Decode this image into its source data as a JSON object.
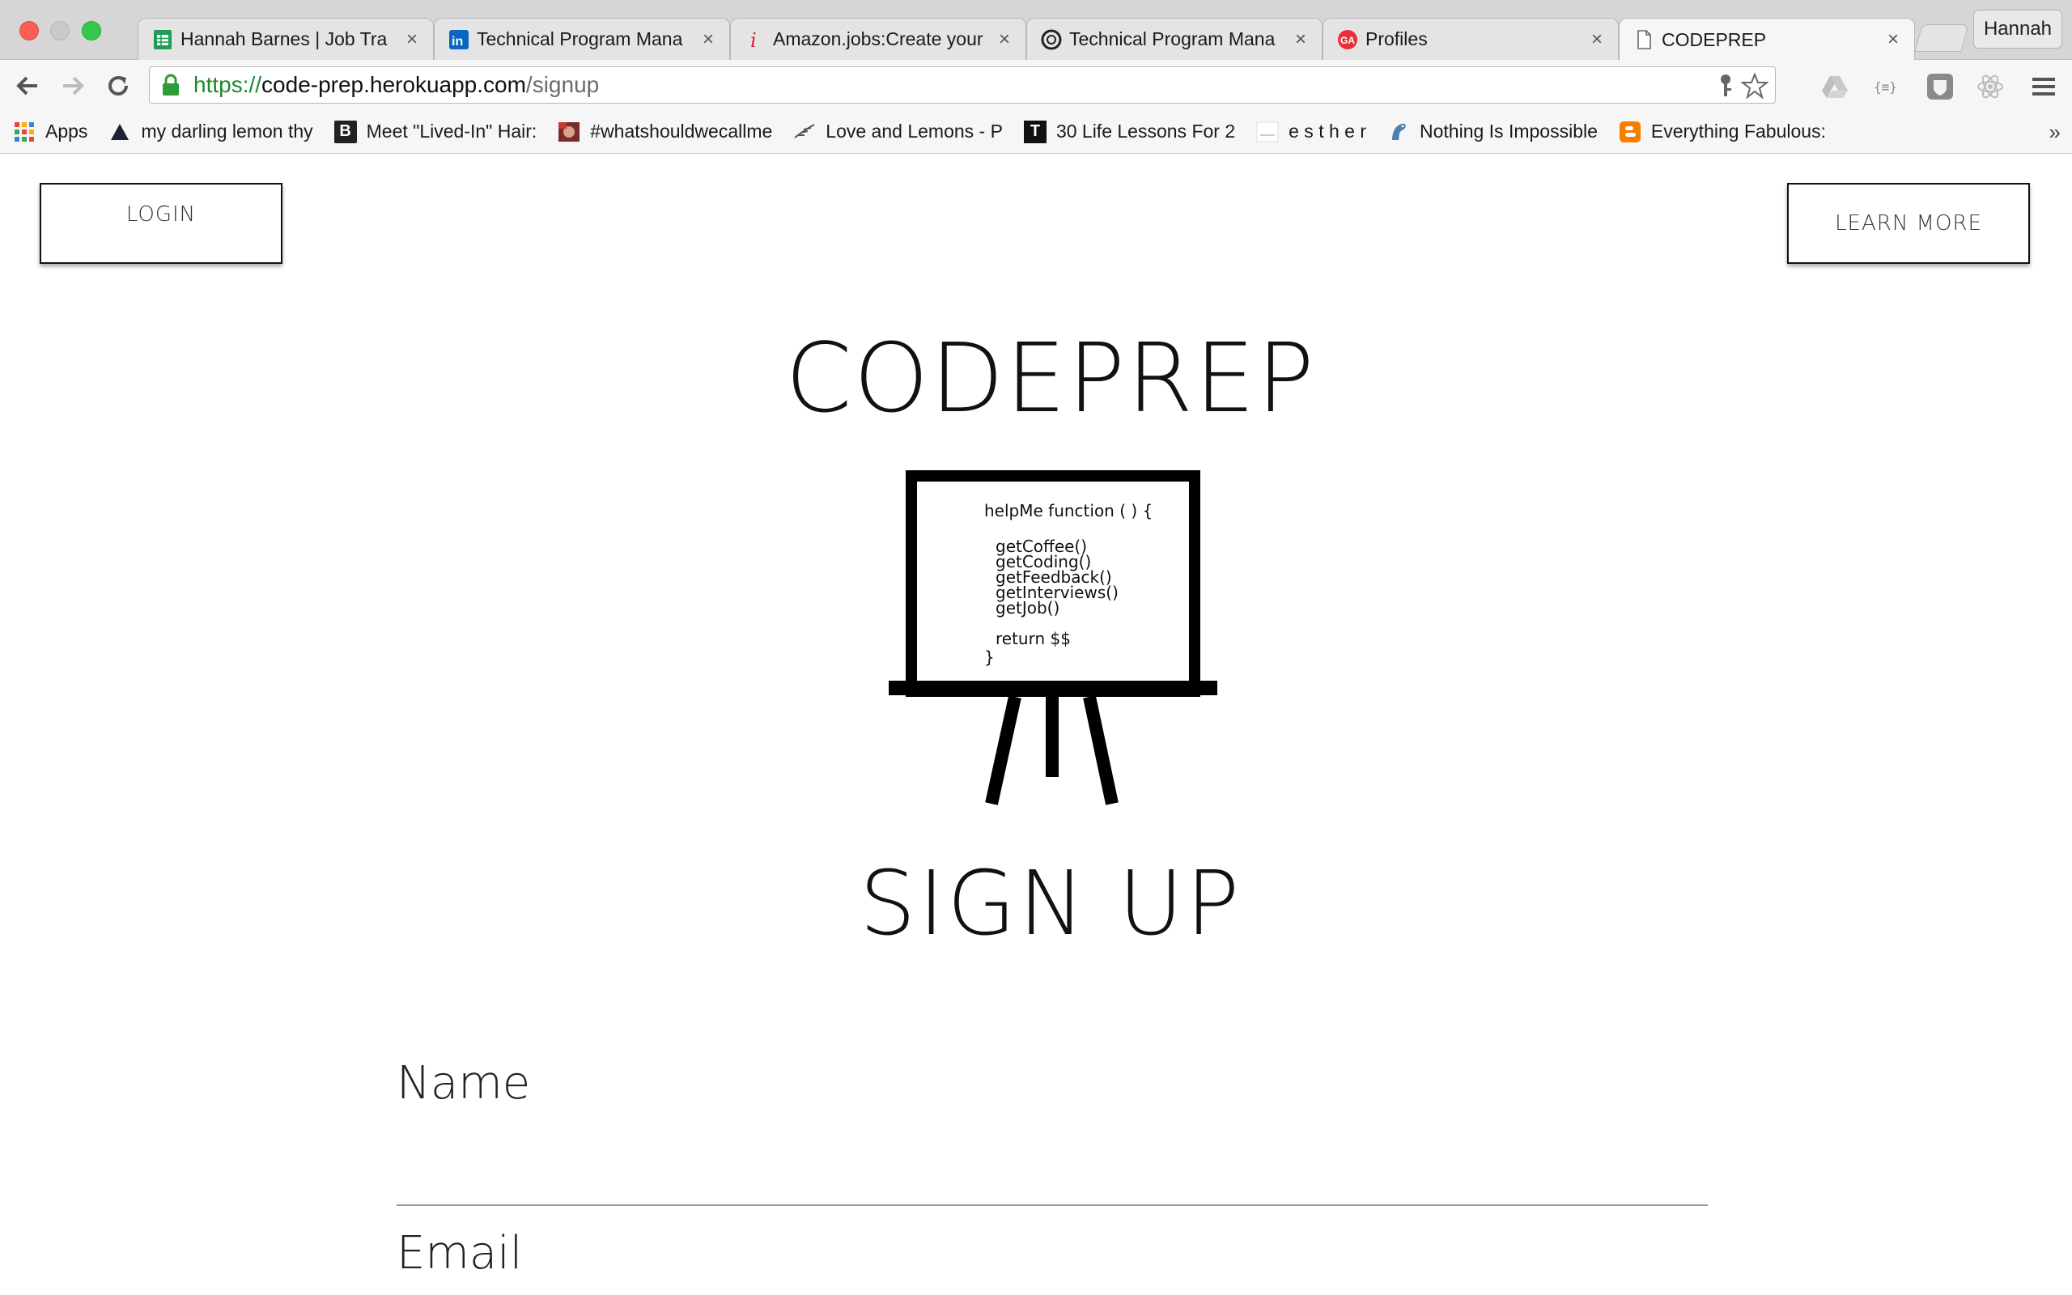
{
  "browser": {
    "tabs": [
      {
        "label": "Hannah Barnes | Job Tra",
        "icon": "google-sheets-icon",
        "active": false
      },
      {
        "label": "Technical Program Mana",
        "icon": "linkedin-icon",
        "active": false
      },
      {
        "label": "Amazon.jobs:Create your",
        "icon": "amazon-jobs-icon",
        "active": false
      },
      {
        "label": "Technical Program Mana",
        "icon": "circle-logo-icon",
        "active": false
      },
      {
        "label": "Profiles",
        "icon": "general-assembly-icon",
        "active": false
      },
      {
        "label": "CODEPREP",
        "icon": "document-icon",
        "active": true
      }
    ],
    "close_glyph": "×",
    "profile_name": "Hannah",
    "url": {
      "scheme": "https://",
      "host": "code-prep.herokuapp.com",
      "path": "/signup"
    },
    "bookmarks": [
      {
        "label": "Apps",
        "icon": "apps-grid-icon"
      },
      {
        "label": "my darling lemon thy",
        "icon": "triangle-icon"
      },
      {
        "label": "Meet \"Lived-In\" Hair:",
        "icon": "b-logo-icon",
        "glyph": "B"
      },
      {
        "label": "#whatshouldwecallme",
        "icon": "photo-icon"
      },
      {
        "label": "Love and Lemons - P",
        "icon": "feather-icon"
      },
      {
        "label": "30 Life Lessons For 2",
        "icon": "t-logo-icon",
        "glyph": "T"
      },
      {
        "label": "e s t h e r",
        "icon": "esther-icon"
      },
      {
        "label": "Nothing Is Impossible",
        "icon": "bird-icon"
      },
      {
        "label": "Everything Fabulous:",
        "icon": "blogger-icon"
      }
    ],
    "bookmarks_more": "»"
  },
  "page": {
    "login_label": "LOGIN",
    "learn_more_label": "LEARN MORE",
    "brand": "CODEPREP",
    "board_code": [
      "helpMe function ( ) {",
      "getCoffee()",
      "getCoding()",
      "getFeedback()",
      "getInterviews()",
      "getJob()",
      "return $$",
      "}"
    ],
    "signup_title": "SIGN UP",
    "name_label": "Name",
    "email_label": "Email"
  },
  "colors": {
    "tab_strip": "#d6d6d6",
    "url_scheme": "#1e8a2c",
    "page_background": "#ffffff",
    "text": "#111111"
  }
}
